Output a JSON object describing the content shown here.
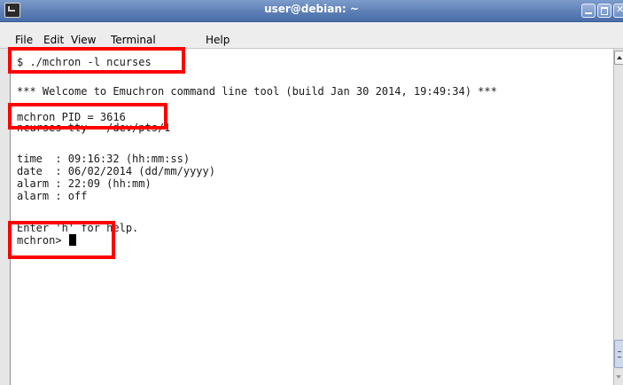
{
  "window": {
    "title": "user@debian: ~",
    "accent": "#5d7fb5"
  },
  "menu": {
    "items": [
      "File",
      "Edit",
      "View",
      "Terminal",
      "Help"
    ]
  },
  "terminal": {
    "lines": [
      "$ ./mchron -l ncurses",
      "",
      "*** Welcome to Emuchron command line tool (build Jan 30 2014, 19:49:34) ***",
      "",
      "mchron PID = 3616",
      "ncurses tty = /dev/pts/1",
      "",
      "time  : 09:16:32 (hh:mm:ss)",
      "date  : 06/02/2014 (dd/mm/yyyy)",
      "alarm : 22:09 (hh:mm)",
      "alarm : off",
      "",
      "Enter 'h' for help.",
      "mchron> "
    ]
  },
  "highlight_color": "#ff0000"
}
